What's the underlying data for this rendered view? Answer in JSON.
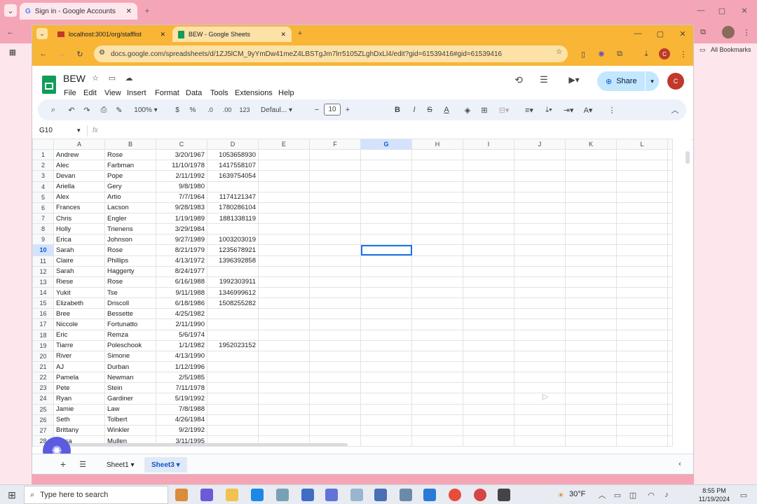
{
  "outer_browser": {
    "tab_title": "Sign in - Google Accounts",
    "bookmarks_label": "All Bookmarks"
  },
  "inner_browser": {
    "tabs": [
      {
        "title": "localhost:3001/org/stafflist"
      },
      {
        "title": "BEW - Google Sheets"
      }
    ],
    "url": "docs.google.com/spreadsheets/d/1ZJ5lCM_9yYmDw41meZ4LBSTgJm7lrr5105ZLghDxLl4/edit?gid=61539416#gid=61539416"
  },
  "doc": {
    "title": "BEW",
    "menus": [
      "File",
      "Edit",
      "View",
      "Insert",
      "Format",
      "Data",
      "Tools",
      "Extensions",
      "Help"
    ],
    "share_label": "Share"
  },
  "toolbar": {
    "zoom": "100%",
    "currency": "$",
    "percent": "%",
    "dec_decrease": ".0",
    "dec_increase": ".00",
    "number_format": "123",
    "font": "Defaul...",
    "font_size": "10"
  },
  "formula": {
    "name_box": "G10",
    "fx": "fx"
  },
  "grid": {
    "columns": [
      "A",
      "B",
      "C",
      "D",
      "E",
      "F",
      "G",
      "H",
      "I",
      "J",
      "K",
      "L"
    ],
    "selected_column": "G",
    "selected_row": "10",
    "rows": [
      {
        "n": "1",
        "a": "Andrew",
        "b": "Rose",
        "c": "3/20/1967",
        "d": "1053658930"
      },
      {
        "n": "2",
        "a": "Alec",
        "b": "Farbman",
        "c": "11/10/1978",
        "d": "1417558107"
      },
      {
        "n": "3",
        "a": "Devan",
        "b": "Pope",
        "c": "2/11/1992",
        "d": "1639754054"
      },
      {
        "n": "4",
        "a": "Ariella",
        "b": "Gery",
        "c": "9/8/1980",
        "d": ""
      },
      {
        "n": "5",
        "a": "Alex",
        "b": "Artio",
        "c": "7/7/1964",
        "d": "1174121347"
      },
      {
        "n": "6",
        "a": "Frances",
        "b": "Lacson",
        "c": "9/28/1983",
        "d": "1780286104"
      },
      {
        "n": "7",
        "a": "Chris",
        "b": "Engler",
        "c": "1/19/1989",
        "d": "1881338119"
      },
      {
        "n": "8",
        "a": "Holly",
        "b": "Trienens",
        "c": "3/29/1984",
        "d": ""
      },
      {
        "n": "9",
        "a": "Erica",
        "b": "Johnson",
        "c": "9/27/1989",
        "d": "1003203019"
      },
      {
        "n": "10",
        "a": "Sarah",
        "b": "Rose",
        "c": "8/21/1979",
        "d": "1235678921"
      },
      {
        "n": "11",
        "a": "Claire",
        "b": "Phillips",
        "c": "4/13/1972",
        "d": "1396392858"
      },
      {
        "n": "12",
        "a": "Sarah",
        "b": "Haggerty",
        "c": "8/24/1977",
        "d": ""
      },
      {
        "n": "13",
        "a": "Riese",
        "b": "Rose",
        "c": "6/16/1988",
        "d": "1992303911"
      },
      {
        "n": "14",
        "a": "Yukit",
        "b": "Tse",
        "c": "9/11/1988",
        "d": "1346999612"
      },
      {
        "n": "15",
        "a": "Elizabeth",
        "b": "Driscoll",
        "c": "6/18/1986",
        "d": "1508255282"
      },
      {
        "n": "16",
        "a": "Bree",
        "b": "Bessette",
        "c": "4/25/1982",
        "d": ""
      },
      {
        "n": "17",
        "a": "Niccole",
        "b": "Fortunatto",
        "c": "2/11/1990",
        "d": ""
      },
      {
        "n": "18",
        "a": "Eric",
        "b": "Remza",
        "c": "5/6/1974",
        "d": ""
      },
      {
        "n": "19",
        "a": "Tiarre",
        "b": "Poleschook",
        "c": "1/1/1982",
        "d": "1952023152"
      },
      {
        "n": "20",
        "a": "River",
        "b": "Simone",
        "c": "4/13/1990",
        "d": ""
      },
      {
        "n": "21",
        "a": "AJ",
        "b": "Durban",
        "c": "1/12/1996",
        "d": ""
      },
      {
        "n": "22",
        "a": "Pamela",
        "b": "Newman",
        "c": "2/5/1985",
        "d": ""
      },
      {
        "n": "23",
        "a": "Pete",
        "b": "Stein",
        "c": "7/11/1978",
        "d": ""
      },
      {
        "n": "24",
        "a": "Ryan",
        "b": "Gardiner",
        "c": "5/19/1992",
        "d": ""
      },
      {
        "n": "25",
        "a": "Jamie",
        "b": "Law",
        "c": "7/8/1988",
        "d": ""
      },
      {
        "n": "26",
        "a": "Seth",
        "b": "Tolbert",
        "c": "4/26/1984",
        "d": ""
      },
      {
        "n": "27",
        "a": "Brittany",
        "b": "Winkler",
        "c": "9/2/1992",
        "d": ""
      },
      {
        "n": "28",
        "a": "...ssa",
        "b": "Mullen",
        "c": "3/11/1995",
        "d": ""
      }
    ]
  },
  "sheet_tabs": [
    "Sheet1",
    "Sheet3"
  ],
  "active_sheet": "Sheet3",
  "taskbar": {
    "search_placeholder": "Type here to search",
    "weather": "30°F",
    "time": "8:55 PM",
    "date": "11/19/2024"
  },
  "colors": {
    "outer_chrome": "#f4a6b6",
    "inner_chrome": "#f9b536",
    "selection": "#1a73e8",
    "share_bg": "#c2e7ff"
  }
}
